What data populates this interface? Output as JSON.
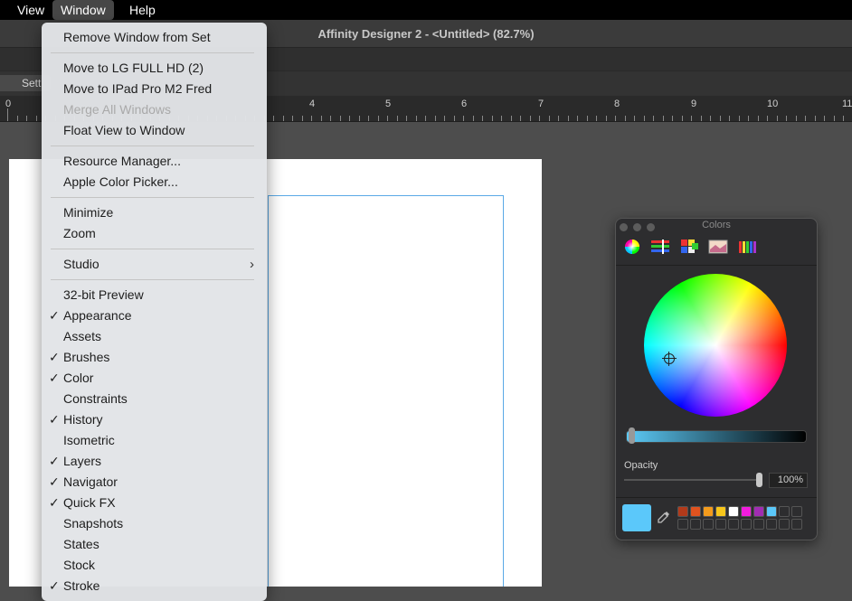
{
  "menubar": {
    "items": [
      "View",
      "Window",
      "Help"
    ],
    "active": "Window"
  },
  "app": {
    "title": "Affinity Designer 2 - <Untitled> (82.7%)",
    "settings_label": "Sett"
  },
  "ruler": {
    "labels": [
      "0",
      "4",
      "5",
      "6",
      "7",
      "8",
      "9",
      "10",
      "11"
    ]
  },
  "window_menu": {
    "items": [
      {
        "label": "Remove Window from Set",
        "checked": false,
        "disabled": false
      },
      {
        "label": "Move to LG FULL HD (2)",
        "checked": false,
        "disabled": false
      },
      {
        "label": "Move to IPad Pro M2 Fred",
        "checked": false,
        "disabled": false
      },
      {
        "label": "Merge All Windows",
        "checked": false,
        "disabled": true
      },
      {
        "label": "Float View to Window",
        "checked": false,
        "disabled": false
      },
      {
        "label": "Resource Manager...",
        "checked": false,
        "disabled": false
      },
      {
        "label": "Apple Color Picker...",
        "checked": false,
        "disabled": false
      },
      {
        "label": "Minimize",
        "checked": false,
        "disabled": false
      },
      {
        "label": "Zoom",
        "checked": false,
        "disabled": false
      },
      {
        "label": "Studio",
        "checked": false,
        "disabled": false,
        "submenu": true
      },
      {
        "label": "32-bit Preview",
        "checked": false,
        "disabled": false
      },
      {
        "label": "Appearance",
        "checked": true,
        "disabled": false
      },
      {
        "label": "Assets",
        "checked": false,
        "disabled": false
      },
      {
        "label": "Brushes",
        "checked": true,
        "disabled": false
      },
      {
        "label": "Color",
        "checked": true,
        "disabled": false
      },
      {
        "label": "Constraints",
        "checked": false,
        "disabled": false
      },
      {
        "label": "History",
        "checked": true,
        "disabled": false
      },
      {
        "label": "Isometric",
        "checked": false,
        "disabled": false
      },
      {
        "label": "Layers",
        "checked": true,
        "disabled": false
      },
      {
        "label": "Navigator",
        "checked": true,
        "disabled": false
      },
      {
        "label": "Quick FX",
        "checked": true,
        "disabled": false
      },
      {
        "label": "Snapshots",
        "checked": false,
        "disabled": false
      },
      {
        "label": "States",
        "checked": false,
        "disabled": false
      },
      {
        "label": "Stock",
        "checked": false,
        "disabled": false
      },
      {
        "label": "Stroke",
        "checked": true,
        "disabled": false
      }
    ],
    "check_glyph": "✓",
    "submenu_glyph": "›"
  },
  "colors_panel": {
    "title": "Colors",
    "opacity_label": "Opacity",
    "opacity_value": "100%",
    "current_color": "#5bc8fa",
    "mode_icons": [
      "color-wheel-icon",
      "color-sliders-icon",
      "color-palettes-icon",
      "image-palettes-icon",
      "pencils-icon"
    ],
    "swatches": [
      "#b23a1a",
      "#e0531f",
      "#f39b1c",
      "#f7c61b",
      "#ffffff",
      "#f21cdd",
      "#a12db3",
      "#5bc8fa",
      "",
      "",
      "",
      "",
      "",
      "",
      "",
      "",
      "",
      "",
      "",
      ""
    ]
  }
}
